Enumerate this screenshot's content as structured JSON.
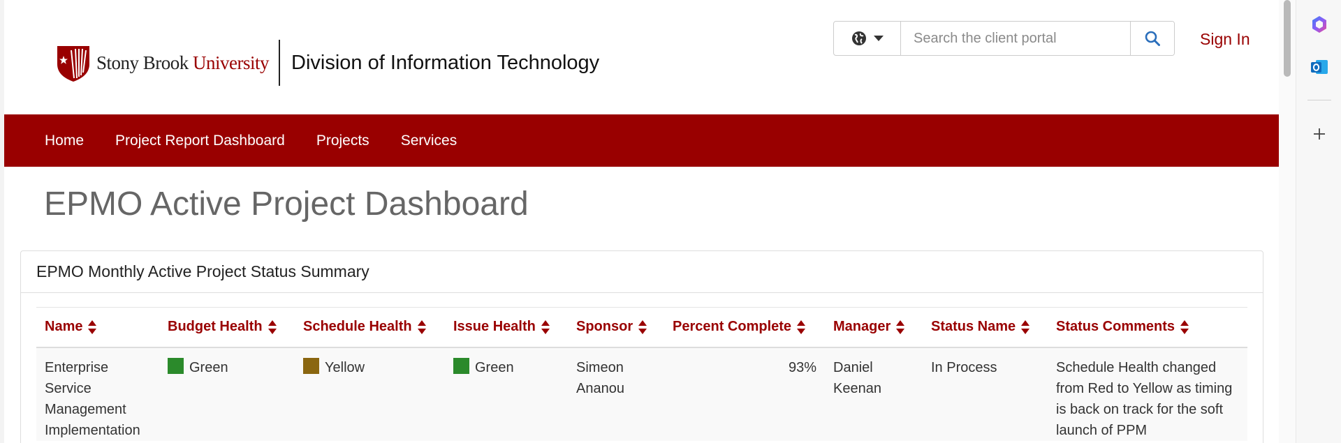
{
  "header": {
    "brand_name": "Stony Brook",
    "brand_university": "University",
    "division": "Division of Information Technology",
    "search_placeholder": "Search the client portal",
    "sign_in": "Sign In"
  },
  "nav": {
    "items": [
      "Home",
      "Project Report Dashboard",
      "Projects",
      "Services"
    ]
  },
  "page": {
    "title": "EPMO Active Project Dashboard"
  },
  "panel": {
    "heading": "EPMO Monthly Active Project Status Summary",
    "columns": [
      "Name",
      "Budget Health",
      "Schedule Health",
      "Issue Health",
      "Sponsor",
      "Percent Complete",
      "Manager",
      "Status Name",
      "Status Comments"
    ],
    "rows": [
      {
        "name": "Enterprise Service Management Implementation",
        "budget_health": "Green",
        "schedule_health": "Yellow",
        "issue_health": "Green",
        "sponsor": "Simeon Ananou",
        "percent_complete": "93%",
        "manager": "Daniel Keenan",
        "status_name": "In Process",
        "status_comments": "Schedule Health changed from Red to Yellow as timing is back on track for the soft launch of PPM"
      }
    ]
  },
  "colors": {
    "brand_red": "#990000",
    "health_green": "#2b8a2b",
    "health_yellow": "#8a6610",
    "outlook_blue": "#0f6cbd"
  },
  "icons": {
    "language": "globe-icon",
    "dropdown": "caret-down-icon",
    "search": "search-icon",
    "sort": "sort-icon",
    "copilot": "copilot-icon",
    "outlook": "outlook-icon",
    "add": "plus-icon"
  }
}
